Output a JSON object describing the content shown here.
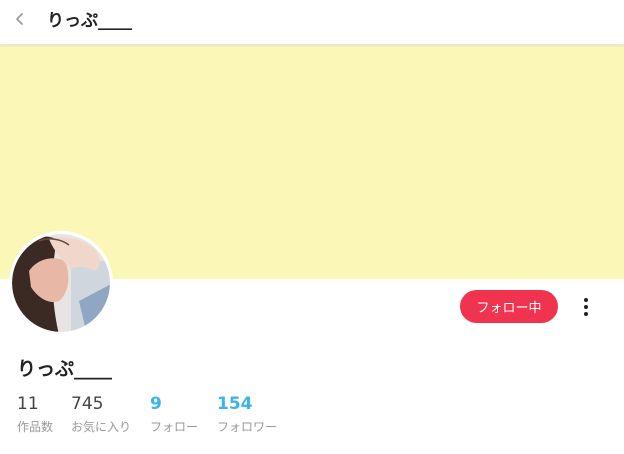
{
  "header": {
    "title": "りっぷ____",
    "back_icon": "chevron-left-icon"
  },
  "profile": {
    "name": "りっぷ____",
    "follow_button_label": "フォロー中",
    "more_icon": "more-vertical-icon"
  },
  "stats": [
    {
      "value": "11",
      "label": "作品数"
    },
    {
      "value": "745",
      "label": "お気に入り"
    },
    {
      "value": "9",
      "label": "フォロー"
    },
    {
      "value": "154",
      "label": "フォロワー"
    }
  ],
  "colors": {
    "cover": "#fbf7b6",
    "follow_button": "#f0334f",
    "accent": "#3cb4ea"
  }
}
